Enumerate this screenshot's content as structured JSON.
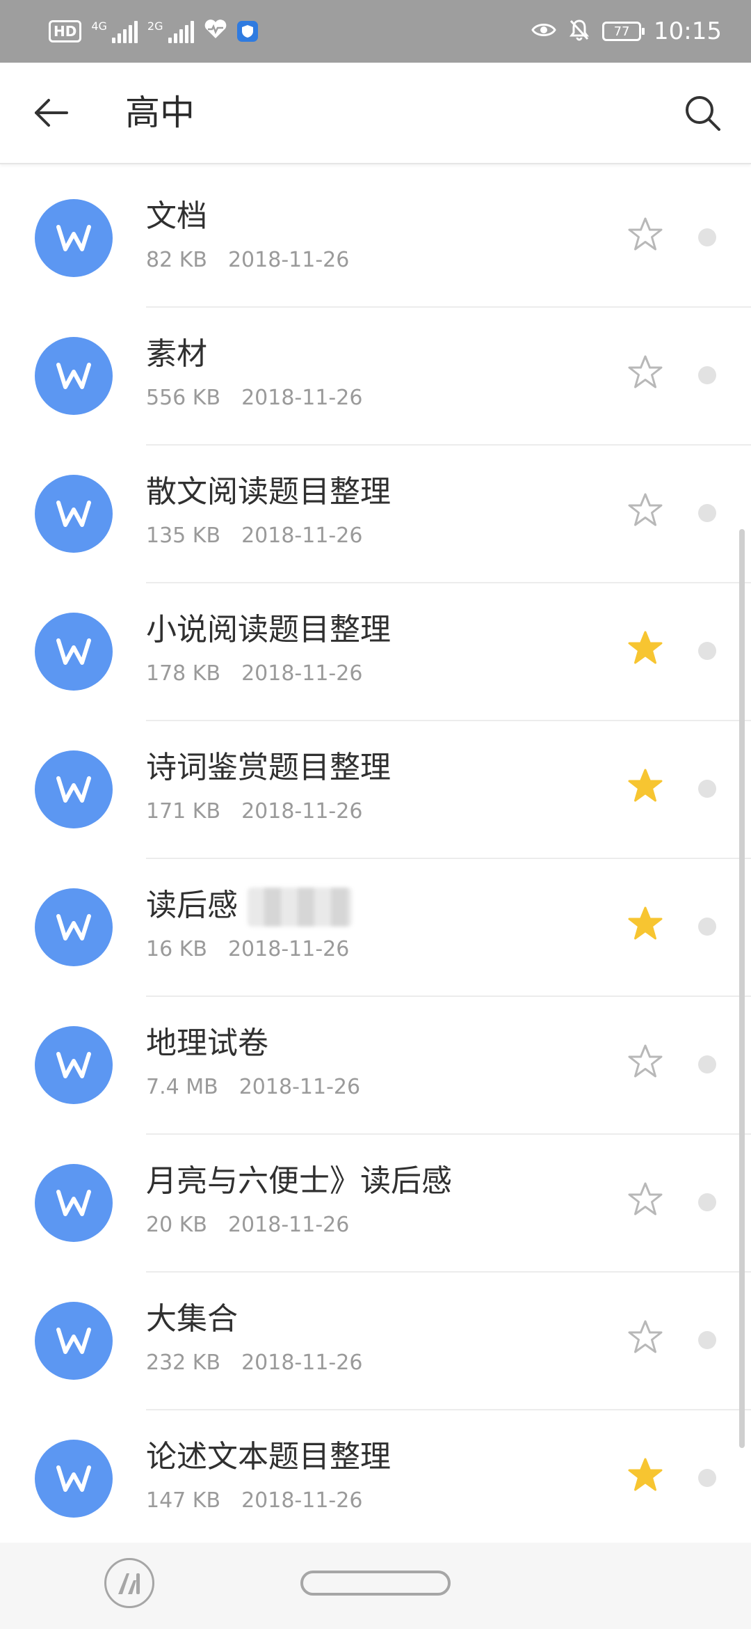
{
  "status_bar": {
    "hd": "HD",
    "net_1": "4G",
    "net_2": "2G",
    "battery": "77",
    "time": "10:15"
  },
  "header": {
    "title": "高中",
    "back_icon": "arrow-left-icon",
    "search_icon": "search-icon"
  },
  "colors": {
    "doc_icon": "#5c97f2",
    "star_active": "#f7c531",
    "star_inactive": "#b8b8b8"
  },
  "files": [
    {
      "name": "文档",
      "size": "82 KB",
      "date": "2018-11-26",
      "starred": false
    },
    {
      "name": "素材",
      "size": "556 KB",
      "date": "2018-11-26",
      "starred": false
    },
    {
      "name": "散文阅读题目整理",
      "size": "135 KB",
      "date": "2018-11-26",
      "starred": false
    },
    {
      "name": "小说阅读题目整理",
      "size": "178 KB",
      "date": "2018-11-26",
      "starred": true
    },
    {
      "name": "诗词鉴赏题目整理",
      "size": "171 KB",
      "date": "2018-11-26",
      "starred": true
    },
    {
      "name": "读后感",
      "size": "16 KB",
      "date": "2018-11-26",
      "starred": true
    },
    {
      "name": "地理试卷",
      "size": "7.4 MB",
      "date": "2018-11-26",
      "starred": false
    },
    {
      "name": "月亮与六便士》读后感",
      "size": "20 KB",
      "date": "2018-11-26",
      "starred": false
    },
    {
      "name": "大集合",
      "size": "232 KB",
      "date": "2018-11-26",
      "starred": false
    },
    {
      "name": "论述文本题目整理",
      "size": "147 KB",
      "date": "2018-11-26",
      "starred": true
    }
  ]
}
